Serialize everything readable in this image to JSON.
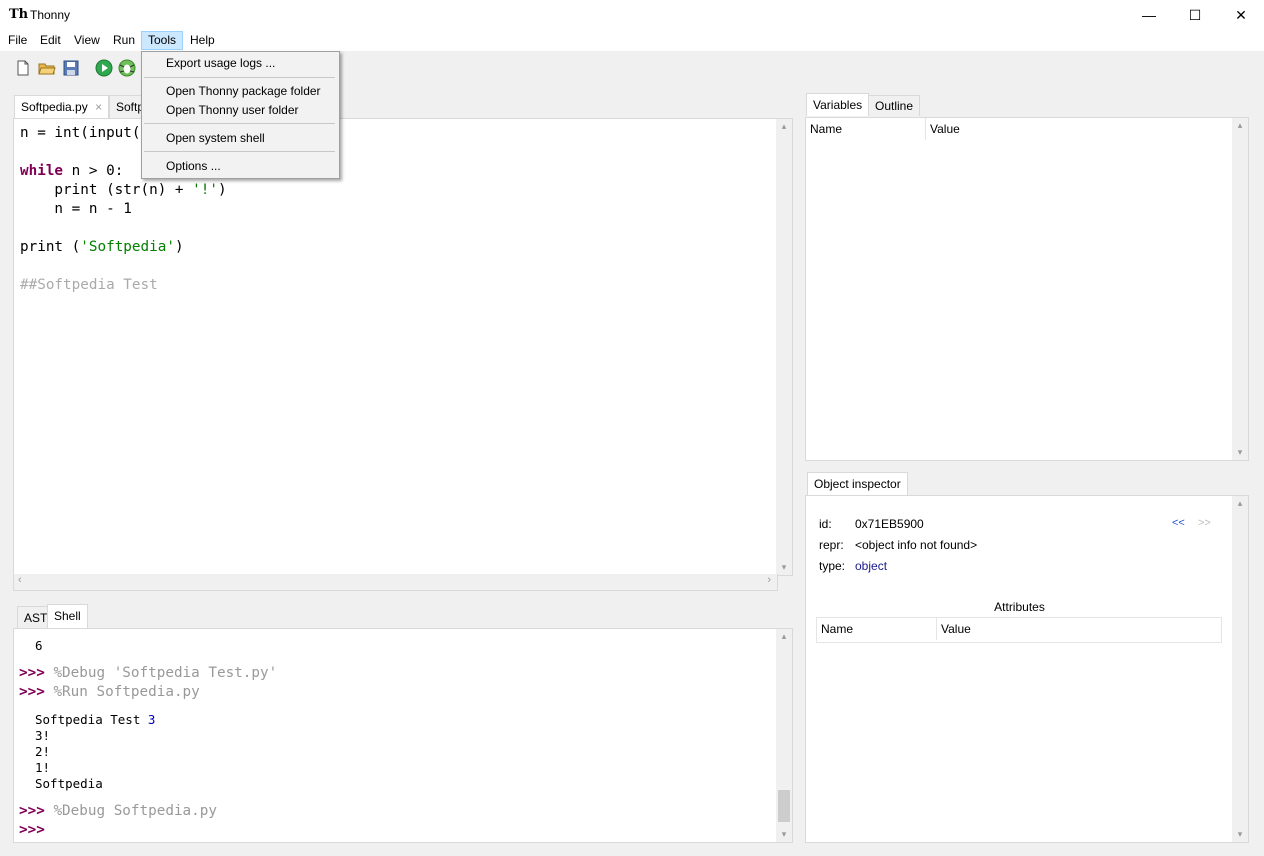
{
  "window": {
    "title": "Thonny"
  },
  "menubar": {
    "items": [
      "File",
      "Edit",
      "View",
      "Run",
      "Tools",
      "Help"
    ]
  },
  "tools_menu": {
    "export_logs": "Export usage logs ...",
    "open_package": "Open Thonny package folder",
    "open_user": "Open Thonny user folder",
    "system_shell": "Open system shell",
    "options": "Options ..."
  },
  "editor": {
    "tabs": [
      "Softpedia.py",
      "Softp"
    ],
    "close_glyph": "×",
    "lines": {
      "l1": "n = int(input(",
      "l2_kw": "while",
      "l2_rest": " n > 0:",
      "l3_a": "    print (str(n) + ",
      "l3_str": "'!'",
      "l3_b": ")",
      "l4": "    n = n - 1",
      "l5_a": "print (",
      "l5_str": "'Softpedia'",
      "l5_b": ")",
      "l6_comment": "##Softpedia Test"
    }
  },
  "bottom_tabs": [
    "AST",
    "Shell"
  ],
  "shell": {
    "out_6": "6",
    "prompt": ">>>",
    "cmd1": "%Debug 'Softpedia Test.py'",
    "cmd2": "%Run Softpedia.py",
    "out_test": "Softpedia Test ",
    "out_test_num": "3",
    "out_3": "3!",
    "out_2": "2!",
    "out_1": "1!",
    "out_sp": "Softpedia",
    "cmd3": "%Debug Softpedia.py"
  },
  "variables_panel": {
    "tabs": [
      "Variables",
      "Outline"
    ],
    "col_name": "Name",
    "col_value": "Value"
  },
  "object_inspector": {
    "tab": "Object inspector",
    "id_label": "id:",
    "id_value": "0x71EB5900",
    "repr_label": "repr:",
    "repr_value": "<object info not found>",
    "type_label": "type:",
    "type_value": "object",
    "nav_back": "<<",
    "nav_forward": ">>",
    "attributes_title": "Attributes",
    "col_name": "Name",
    "col_value": "Value"
  },
  "colors": {
    "keyword": "#7f0055",
    "string": "#007f00",
    "comment": "#aaaaaa",
    "menu_highlight": "#cce8ff"
  }
}
